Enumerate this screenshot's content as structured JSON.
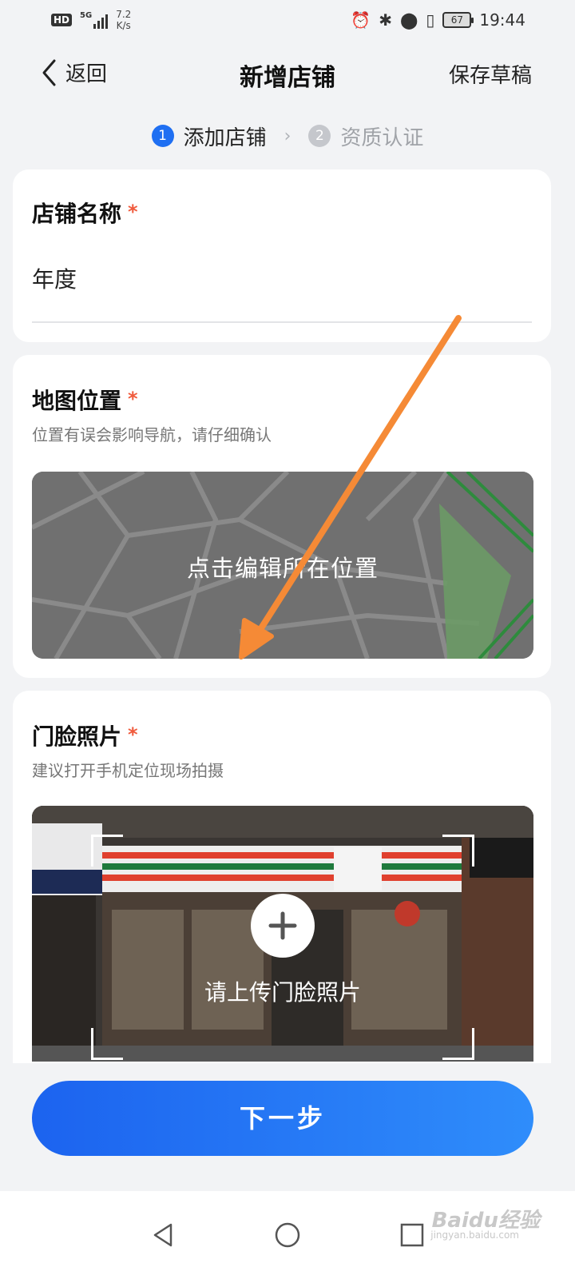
{
  "status_bar": {
    "hd": "HD",
    "network": "5G",
    "speed_value": "7.2",
    "speed_unit": "K/s",
    "battery": "67",
    "time": "19:44"
  },
  "header": {
    "back_label": "返回",
    "title": "新增店铺",
    "save_draft": "保存草稿"
  },
  "steps": [
    {
      "num": "1",
      "label": "添加店铺",
      "active": true
    },
    {
      "num": "2",
      "label": "资质认证",
      "active": false
    }
  ],
  "store_name": {
    "label": "店铺名称",
    "required_mark": "*",
    "value": "年度"
  },
  "map_location": {
    "label": "地图位置",
    "required_mark": "*",
    "hint": "位置有误会影响导航，请仔细确认",
    "edit_prompt": "点击编辑所在位置"
  },
  "storefront_photo": {
    "label": "门脸照片",
    "required_mark": "*",
    "hint": "建议打开手机定位现场拍摄",
    "upload_prompt": "请上传门脸照片"
  },
  "next_button": "下一步",
  "watermark": {
    "main": "Baidu经验",
    "sub": "jingyan.baidu.com"
  },
  "colors": {
    "primary": "#1f6ff2",
    "required": "#f05a3c",
    "annotation_arrow": "#f58a36"
  }
}
